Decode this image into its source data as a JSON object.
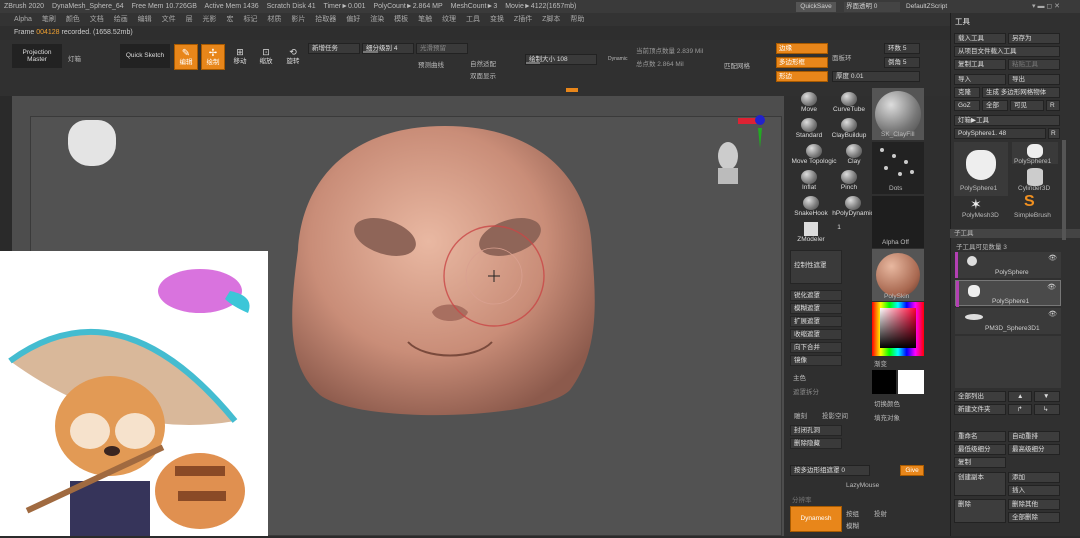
{
  "titlebar": {
    "items": [
      "ZBrush 2020",
      "DynaMesh_Sphere_64",
      "Free Mem 10.726GB",
      "Active Mem 1436",
      "Scratch Disk 41",
      "Timer►0.001",
      "PolyCount►2.864 MP",
      "MeshCount►3",
      "Movie►4122(1657mb)"
    ],
    "quicksave": "QuickSave",
    "transparency": "界面透明 0",
    "script": "DefaultZScript"
  },
  "menubar": {
    "items": [
      "Alpha",
      "笔刷",
      "颜色",
      "文档",
      "绘画",
      "编辑",
      "文件",
      "层",
      "光影",
      "宏",
      "标记",
      "材质",
      "影片",
      "拾取器",
      "偏好",
      "渲染",
      "模板",
      "笔触",
      "纹理",
      "工具",
      "变换",
      "Z插件",
      "Z脚本",
      "帮助"
    ]
  },
  "framebar": {
    "prefix": "Frame",
    "frame": "004128",
    "suffix": "recorded. (1658.52mb)"
  },
  "toolbar": {
    "projection_master": "Projection Master",
    "lightbox": "灯箱",
    "quick_sketch": "Quick Sketch",
    "edit": "编辑",
    "draw": "绘制",
    "move": "移动",
    "scale": "缩放",
    "rotate": "旋转",
    "subdiv_label": "细分级别",
    "subdiv_value": "4",
    "add_slider": "新增任务",
    "smooth_label": "光滑预留",
    "repeat": "预测曲线",
    "draw_size_label": "绘制大小",
    "draw_size_value": "108",
    "dynamic": "Dynamic",
    "current_points": "当前顶点数量 2.839 Mil",
    "total_points": "总点数 2.864 Mil",
    "focal": "自然适配",
    "dual": "双面显示",
    "match_mesh": "匹配网格",
    "edge": "边缘",
    "poly_frame": "多边形框",
    "edge2": "形边",
    "face_ring": "面板环",
    "ring_label": "环数",
    "ring_value": "5",
    "thickness_label": "厚度",
    "thickness_value": "0.01",
    "bevel_label": "倒角",
    "bevel_value": "5"
  },
  "rightshelf": {
    "brushes": [
      "Move",
      "CurveTube",
      "Standard",
      "ClayBuildup",
      "Move Topologic",
      "Clay",
      "Inflat",
      "Pinch",
      "SnakeHook",
      "hPolyDynamic",
      "ZModeler"
    ],
    "zmodeler_count": "1",
    "clayfill": "SK_ClayFill",
    "dots": "Dots",
    "alpha_off": "Alpha Off",
    "polyskin": "PolySkin",
    "gradient": "渐变",
    "main_color": "主色",
    "switch_color": "切换颜色",
    "fill_object": "填充对象",
    "menu": [
      "控制性遮罩",
      "锐化遮罩",
      "模糊遮罩",
      "扩展遮罩",
      "收缩遮罩",
      "向下合并",
      "镜像"
    ],
    "masks_split": "遮罩拆分",
    "hide_pt": "雕刻",
    "stroke_lbl": "投影空间",
    "close_holes": "封闭孔洞",
    "delete_hidden": "删除隐藏",
    "group_poly": "按多边形组遮罩",
    "group_poly_value": "0",
    "give": "Give",
    "lazymouse": "LazyMouse",
    "dynamesh": "Dynamesh",
    "resolution": "分辨率",
    "poly_group": "按组",
    "blur": "模糊",
    "project": "投射"
  },
  "tray": {
    "title": "工具",
    "buttons": [
      [
        "载入工具",
        "另存为"
      ],
      [
        "从项目文件载入工具",
        ""
      ],
      [
        "复制工具",
        "粘贴工具"
      ],
      [
        "导入",
        "导出"
      ],
      [
        "克隆",
        "生成 多边形网格物体"
      ],
      [
        "GoZ",
        "全部"
      ],
      [
        "可见",
        "R"
      ]
    ],
    "lightbox_tool": "灯箱▶工具",
    "polysphere_slider": "PolySphere1. 48",
    "tools": [
      "PolySphere1",
      "PolySphere1",
      "Cylinder3D",
      "PolyMesh3D",
      "SimpleBrush"
    ],
    "subtool_header": "子工具",
    "visible_count": "子工具可见数量 3",
    "subtools": [
      "PolySphere",
      "PolySphere1",
      "PM3D_Sphere3D1"
    ],
    "list_all": "全部列出",
    "new_folder": "新建文件夹",
    "actions": [
      [
        "重命名",
        "自动重排"
      ],
      [
        "最低级细分",
        "最高级细分"
      ],
      [
        "复制",
        ""
      ],
      [
        "创建副本",
        "添加"
      ],
      [
        "",
        "插入"
      ],
      [
        "删除",
        "删除其他"
      ],
      [
        "",
        "全部删除"
      ]
    ]
  }
}
